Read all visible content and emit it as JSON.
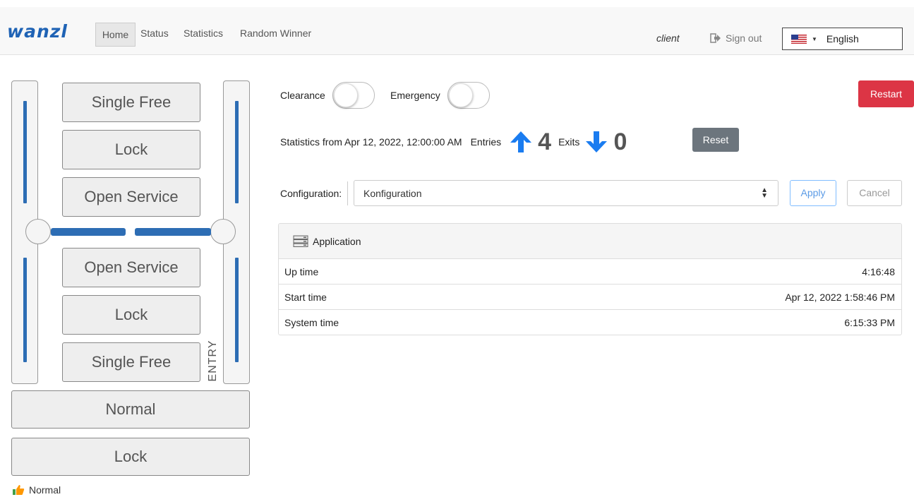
{
  "header": {
    "logo": "wanzl",
    "nav": [
      "Home",
      "Status",
      "Statistics",
      "Random Winner"
    ],
    "user": "client",
    "signout_label": "Sign out",
    "language": "English"
  },
  "diagram": {
    "upper_modes": [
      "Single Free",
      "Lock",
      "Open Service"
    ],
    "lower_modes": [
      "Open Service",
      "Lock",
      "Single Free"
    ],
    "entry_label": "ENTRY",
    "bottom_modes": [
      "Normal",
      "Lock"
    ],
    "status": "Normal"
  },
  "controls": {
    "clearance_label": "Clearance",
    "clearance_on": false,
    "emergency_label": "Emergency",
    "emergency_on": false,
    "restart_label": "Restart",
    "stats_prefix": "Statistics from Apr 12, 2022, 12:00:00 AM",
    "entries_label": "Entries",
    "entries_count": "4",
    "exits_label": "Exits",
    "exits_count": "0",
    "reset_label": "Reset",
    "config_label": "Configuration:",
    "config_value": "Konfiguration",
    "apply_label": "Apply",
    "cancel_label": "Cancel"
  },
  "application": {
    "title": "Application",
    "rows": [
      {
        "key": "Up time",
        "value": "4:16:48"
      },
      {
        "key": "Start time",
        "value": "Apr 12, 2022 1:58:46 PM"
      },
      {
        "key": "System time",
        "value": "6:15:33 PM"
      }
    ]
  },
  "colors": {
    "brand": "#1f63b5",
    "gate": "#2d6db4",
    "restart": "#dc3545",
    "reset": "#6c757d",
    "arrow": "#1a7cf0"
  }
}
